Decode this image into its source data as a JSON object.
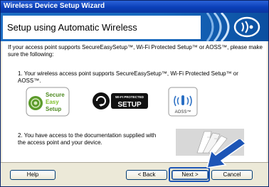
{
  "window": {
    "title": "Wireless Device Setup Wizard"
  },
  "header": {
    "title": "Setup using Automatic Wireless",
    "icon": "wireless-waves-icon"
  },
  "content": {
    "intro": "If your access point supports SecureEasySetup™, Wi-Fi Protected Setup™ or AOSS™, please make sure the following:",
    "requirement_1": "1. Your wireless access point supports SecureEasySetup™, Wi-Fi Protected Setup™ or AOSS™.",
    "requirement_2": "2. You have access to the documentation supplied with the access point and your device.",
    "logos": {
      "secure_easy_setup": {
        "line1": "Secure",
        "line2": "Easy",
        "line3": "Setup"
      },
      "wps": {
        "top": "WI-FI PROTECTED",
        "bottom": "SETUP"
      },
      "aoss": {
        "label": "AOSS™"
      }
    }
  },
  "buttons": {
    "help": "Help",
    "back": "< Back",
    "next": "Next >",
    "cancel": "Cancel"
  },
  "colors": {
    "title_bar": "#0a3fb8",
    "header_blue": "#1768bd",
    "secure_green": "#5b9a2a",
    "highlight_blue": "#1d55b6"
  }
}
